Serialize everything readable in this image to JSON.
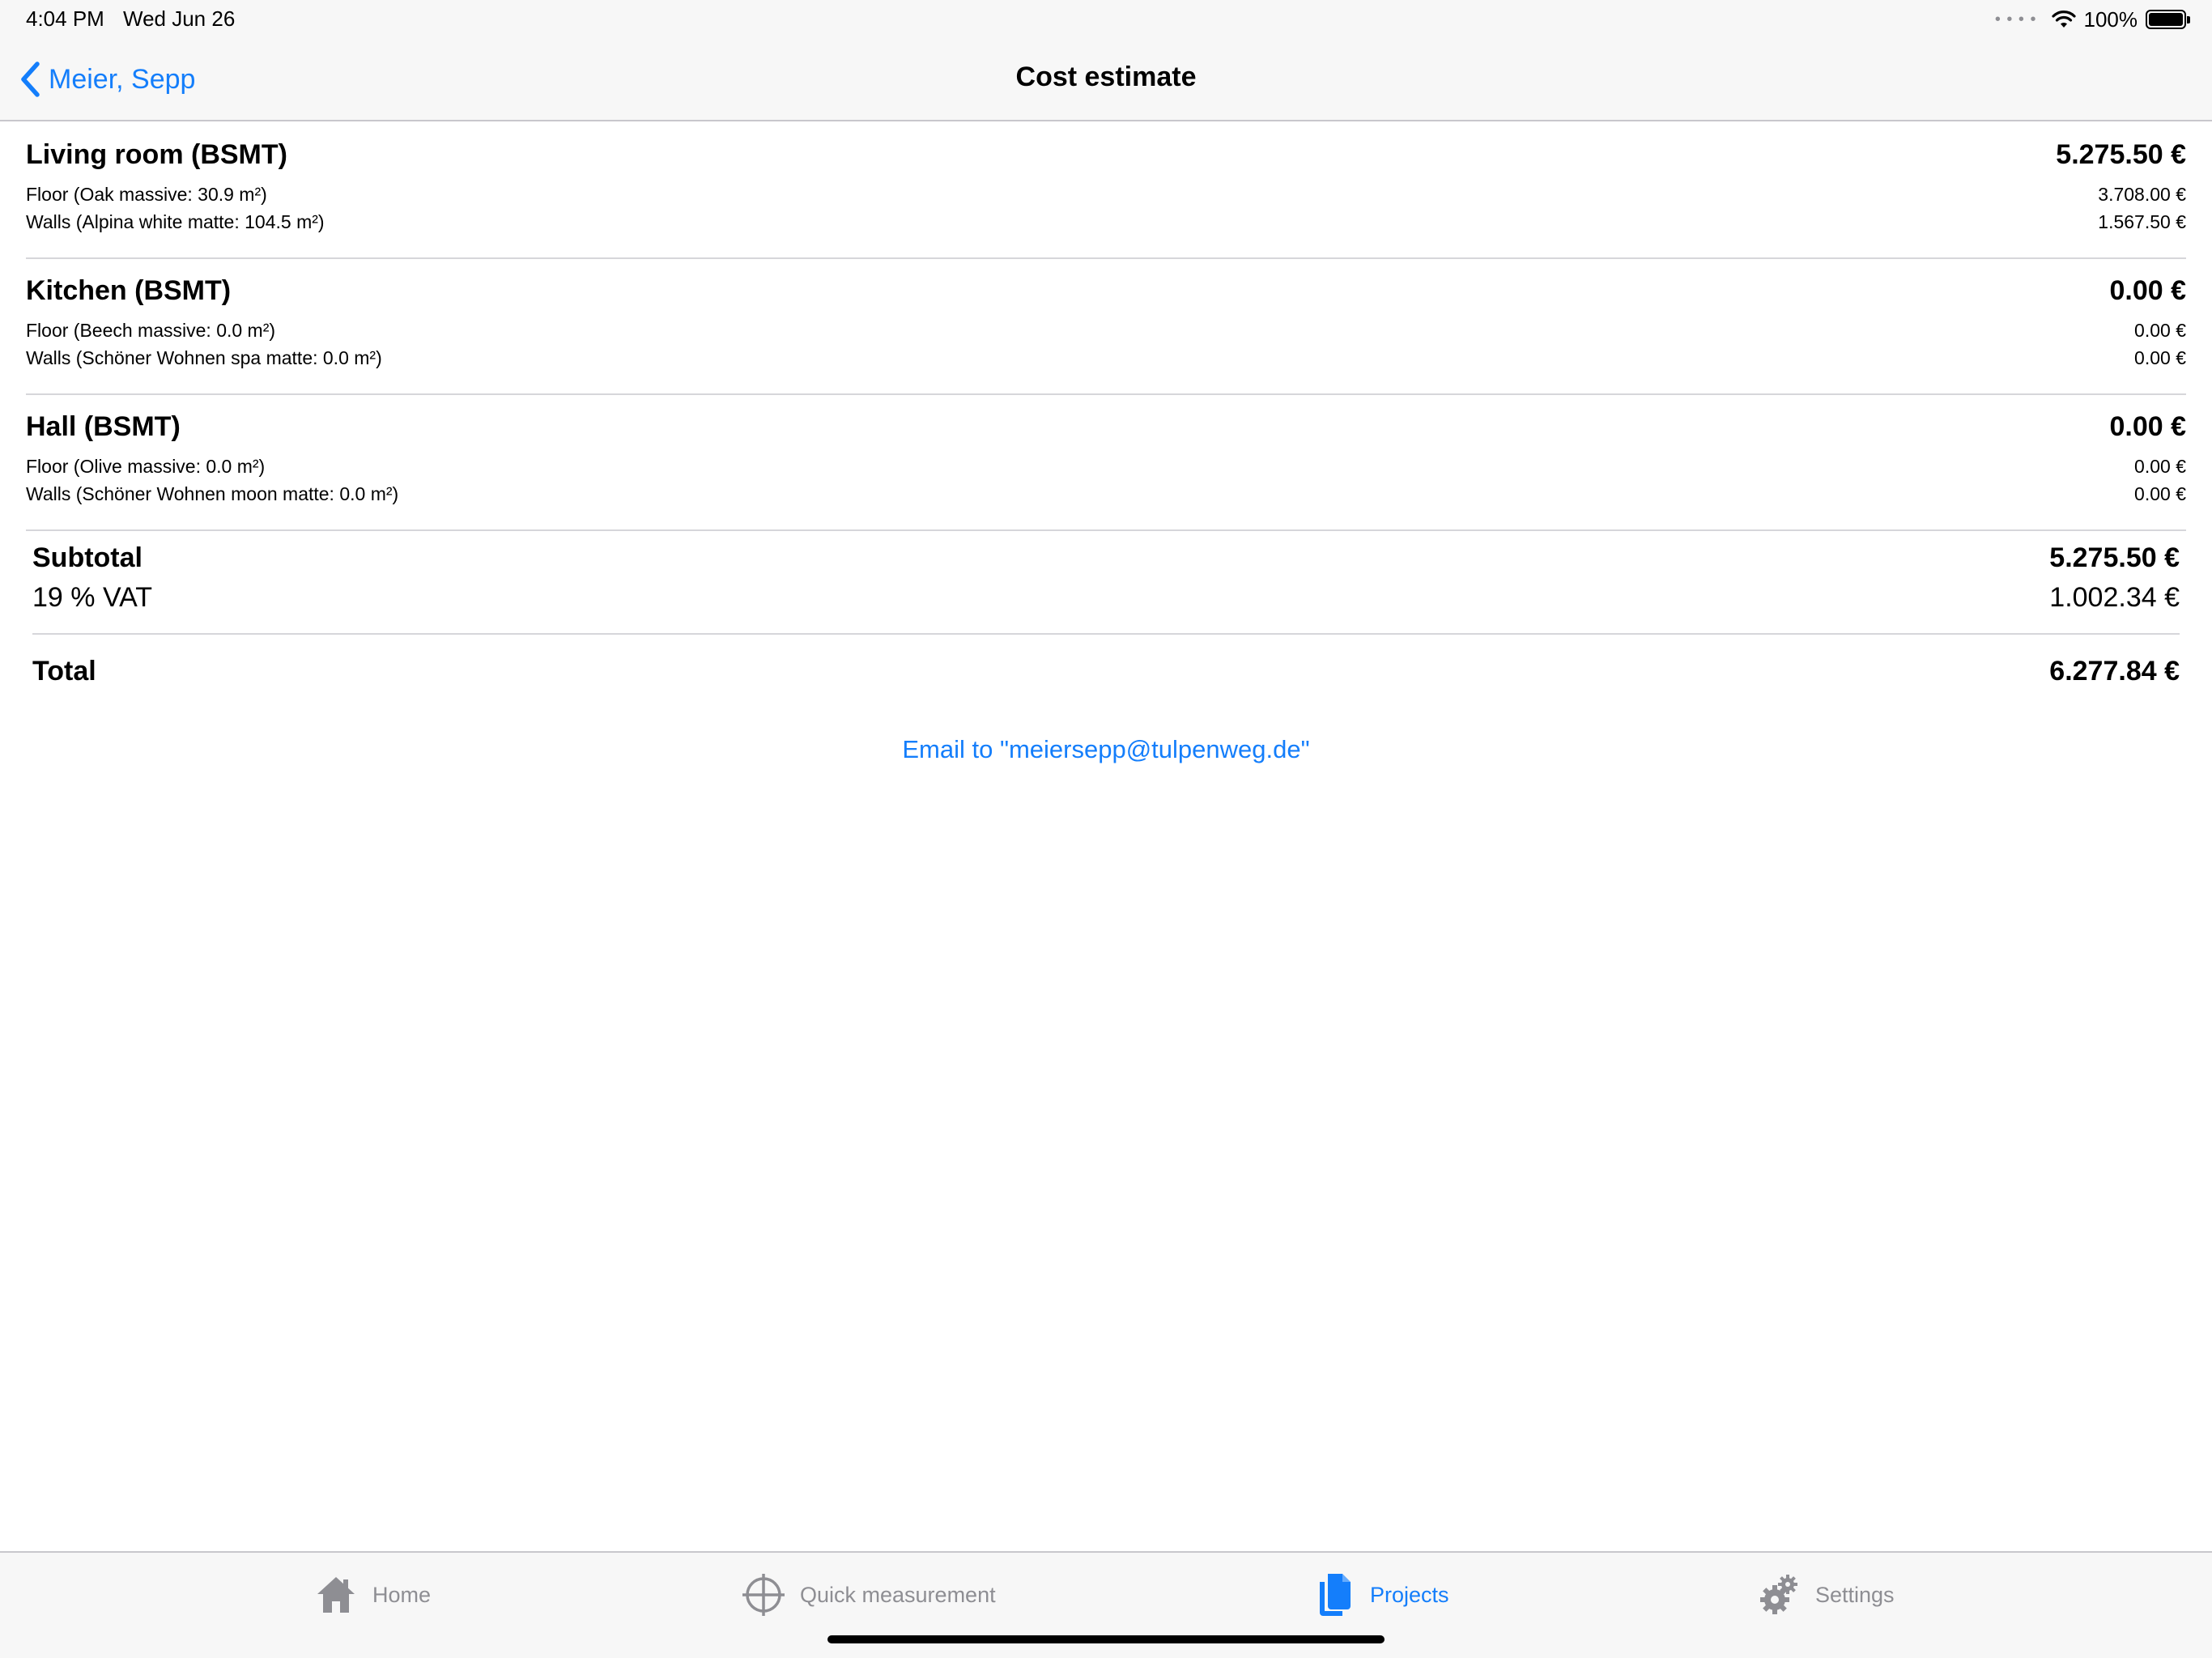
{
  "status_bar": {
    "time": "4:04 PM",
    "date": "Wed Jun 26",
    "battery_percent": "100%",
    "battery_level": 1.0
  },
  "nav": {
    "back_label": "Meier, Sepp",
    "title": "Cost estimate"
  },
  "rooms": [
    {
      "name": "Living room (BSMT)",
      "total": "5.275.50 €",
      "lines": [
        {
          "label": "Floor (Oak massive: 30.9 m²)",
          "value": "3.708.00 €"
        },
        {
          "label": "Walls (Alpina white matte: 104.5 m²)",
          "value": "1.567.50 €"
        }
      ]
    },
    {
      "name": "Kitchen (BSMT)",
      "total": "0.00 €",
      "lines": [
        {
          "label": "Floor (Beech massive: 0.0 m²)",
          "value": "0.00 €"
        },
        {
          "label": "Walls (Schöner Wohnen spa matte: 0.0 m²)",
          "value": "0.00 €"
        }
      ]
    },
    {
      "name": "Hall (BSMT)",
      "total": "0.00 €",
      "lines": [
        {
          "label": "Floor (Olive massive: 0.0 m²)",
          "value": "0.00 €"
        },
        {
          "label": "Walls (Schöner Wohnen moon matte: 0.0 m²)",
          "value": "0.00 €"
        }
      ]
    }
  ],
  "summary": {
    "subtotal_label": "Subtotal",
    "subtotal_value": "5.275.50 €",
    "vat_label": "19 % VAT",
    "vat_value": "1.002.34 €",
    "total_label": "Total",
    "total_value": "6.277.84 €"
  },
  "email_link": "Email to \"meiersepp@tulpenweg.de\"",
  "tabs": [
    {
      "label": "Home",
      "icon": "home-icon",
      "active": false
    },
    {
      "label": "Quick measurement",
      "icon": "crosshair-icon",
      "active": false
    },
    {
      "label": "Projects",
      "icon": "documents-icon",
      "active": true
    },
    {
      "label": "Settings",
      "icon": "gears-icon",
      "active": false
    }
  ],
  "colors": {
    "accent": "#147efb",
    "inactive": "#8e8e93",
    "bar_background": "#f7f7f7",
    "separator": "#d6d6da"
  }
}
